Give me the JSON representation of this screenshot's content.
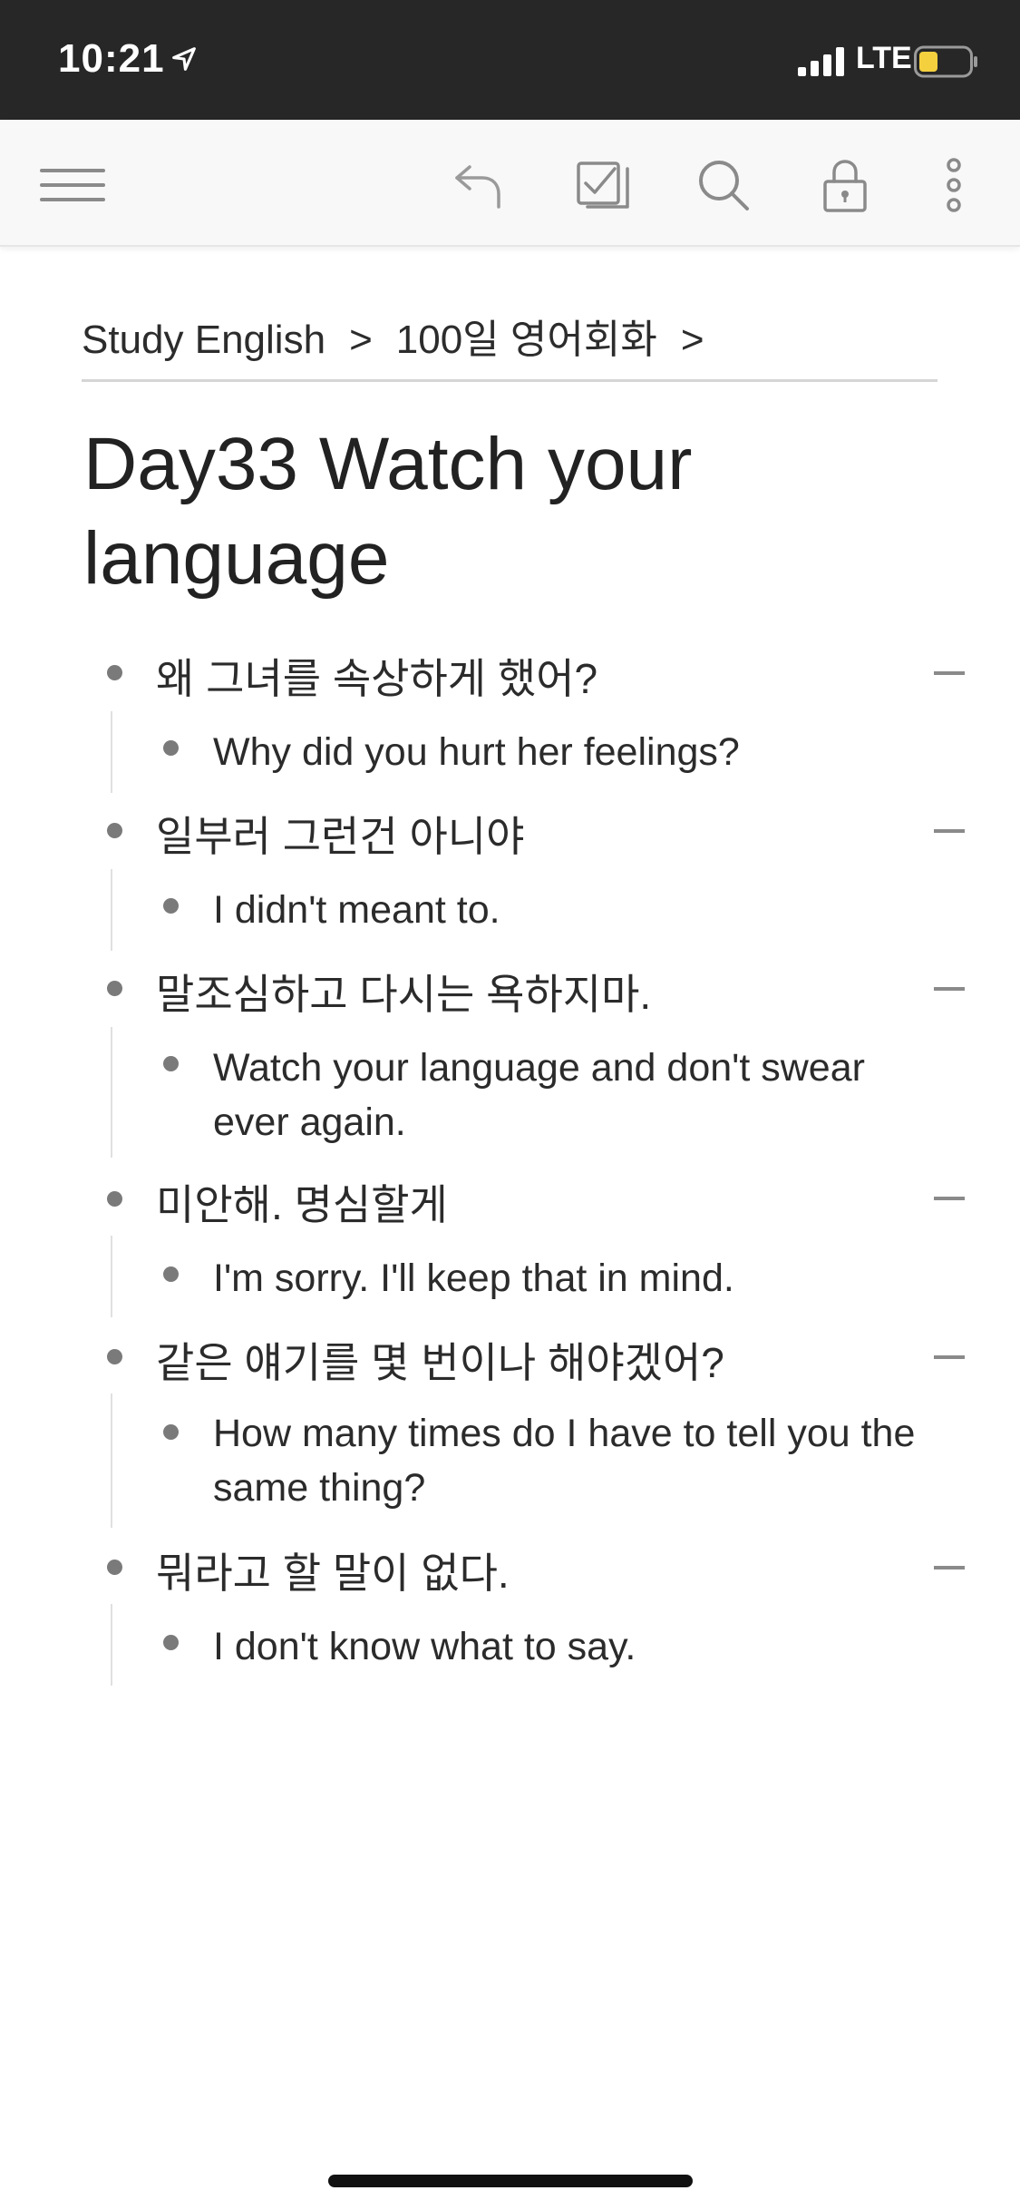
{
  "status_bar": {
    "time": "10:21",
    "network": "LTE",
    "battery_color": "#f4d03f"
  },
  "toolbar": {
    "icons": [
      "menu-icon",
      "undo-icon",
      "checklist-icon",
      "search-icon",
      "lock-icon",
      "more-icon"
    ]
  },
  "breadcrumb": {
    "items": [
      "Study English",
      "100일 영어회화"
    ],
    "separator": ">"
  },
  "page": {
    "title": "Day33 Watch your language"
  },
  "outline": [
    {
      "text": "왜 그녀를 속상하게 했어?",
      "child": "Why did you hurt her feelings?"
    },
    {
      "text": "일부러 그런건 아니야",
      "child": "I didn't meant to."
    },
    {
      "text": "말조심하고 다시는 욕하지마.",
      "child": "Watch your language and don't swear ever again."
    },
    {
      "text": "미안해. 명심할게",
      "child": "I'm sorry. I'll keep that in mind."
    },
    {
      "text": "같은 얘기를 몇 번이나 해야겠어?",
      "child": "How many times do I have to tell you the same thing?"
    },
    {
      "text": "뭐라고 할 말이 없다.",
      "child": "I don't know what to say."
    }
  ]
}
